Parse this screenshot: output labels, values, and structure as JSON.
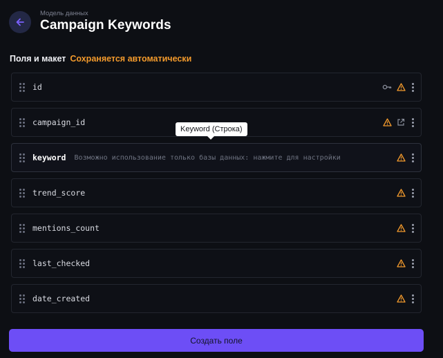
{
  "header": {
    "eyebrow": "Модель данных",
    "title": "Campaign Keywords"
  },
  "section": {
    "label": "Поля и макет",
    "autosave": "Сохраняется автоматически"
  },
  "fields": [
    {
      "name": "id",
      "icons": [
        "key-icon",
        "warning-icon",
        "more-icon"
      ]
    },
    {
      "name": "campaign_id",
      "icons": [
        "warning-icon",
        "external-link-icon",
        "more-icon"
      ]
    },
    {
      "name": "keyword",
      "hint": "Возможно использование только базы данных: нажмите для настройки",
      "icons": [
        "warning-icon",
        "more-icon"
      ]
    },
    {
      "name": "trend_score",
      "icons": [
        "warning-icon",
        "more-icon"
      ]
    },
    {
      "name": "mentions_count",
      "icons": [
        "warning-icon",
        "more-icon"
      ]
    },
    {
      "name": "last_checked",
      "icons": [
        "warning-icon",
        "more-icon"
      ]
    },
    {
      "name": "date_created",
      "icons": [
        "warning-icon",
        "more-icon"
      ]
    }
  ],
  "tooltip": {
    "text": "Keyword (Строка)"
  },
  "create_button": {
    "label": "Создать поле"
  },
  "colors": {
    "accent": "#6d4ef6",
    "warning": "#f39a2c",
    "background": "#0d0f14"
  }
}
